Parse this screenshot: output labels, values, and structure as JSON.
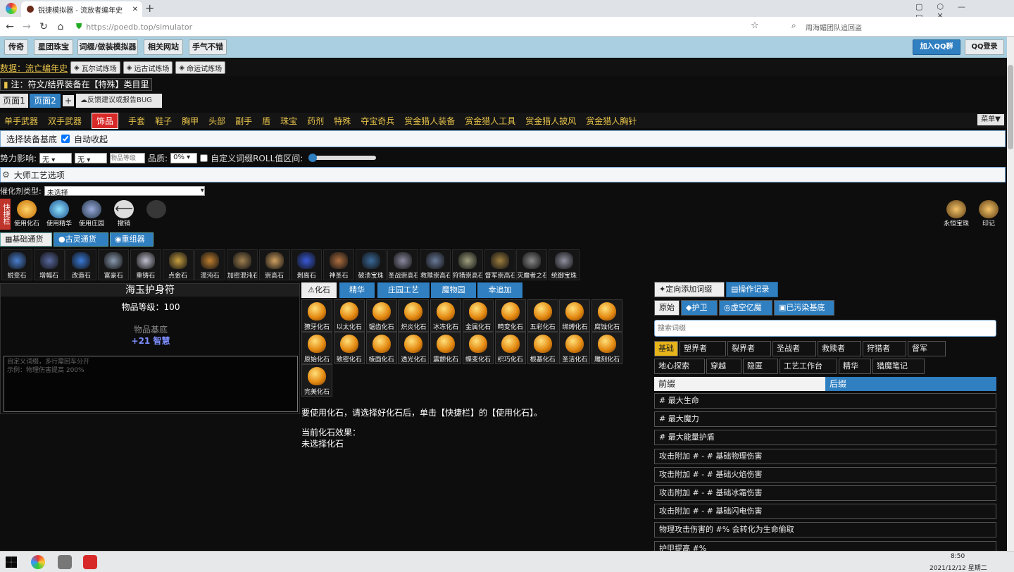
{
  "browser": {
    "tab_title": "锐捷模拟器 - 流放者编年史",
    "new_tab": "+",
    "url": "https://poedb.top/simulator",
    "search_hint": "周海媚团队追回盗"
  },
  "site": {
    "top_nav": [
      "传奇",
      "星团珠宝",
      "词缀/做装模拟器",
      "相关网站",
      "手气不错"
    ],
    "join_qq": "加入QQ群",
    "qq_login": "QQ登录",
    "data_label": "数据：流亡编年史",
    "trials": [
      "瓦尔试炼场",
      "远古试炼场",
      "命运试炼场"
    ],
    "note": "注：符文/结界装备在【特殊】类目里",
    "pages": [
      "页面1",
      "页面2",
      "+"
    ],
    "report_bug": "反馈建议或报告BUG",
    "categories": [
      "单手武器",
      "双手武器",
      "饰品",
      "手套",
      "鞋子",
      "胸甲",
      "头部",
      "副手",
      "盾",
      "珠宝",
      "药剂",
      "特殊",
      "夺宝奇兵",
      "赏金猎人装备",
      "赏金猎人工具",
      "赏金猎人披风",
      "赏金猎人胸针"
    ],
    "active_category": "饰品",
    "menu": "菜单▼",
    "select_base": "选择装备基底",
    "auto_collapse": "自动收起",
    "influence_label": "势力影响:",
    "influence_opt1": "无",
    "influence_opt2": "无",
    "item_level_placeholder": "物品等级",
    "quality_label": "品质:",
    "quality_value": "0%",
    "roll_label": "自定义词缀ROLL值区间:",
    "master_craft": "大师工艺选项",
    "catalyst_label": "催化剂类型:",
    "catalyst_value": "未选择",
    "quickbar_label": "快捷栏",
    "quick": [
      "使用化石",
      "使用精华",
      "使用庄园",
      "撤销",
      ""
    ],
    "quick_right": [
      "永恒宝珠",
      "印记"
    ],
    "sub_tabs": [
      "基础通货",
      "古灵通货",
      "重组器"
    ],
    "currencies": [
      "蜕变石",
      "增幅石",
      "改造石",
      "富豪石",
      "重铸石",
      "点金石",
      "混沌石",
      "加密混沌石",
      "崇高石",
      "剥离石",
      "神圣石",
      "破溃宝珠",
      "圣战崇高石",
      "救赎崇高石",
      "狩猎崇高石",
      "督军崇高石",
      "灭魔者之石",
      "统御宝珠"
    ],
    "item": {
      "name": "海玉护身符",
      "level": "物品等级：100",
      "base_label": "物品基底",
      "base_mod": "+21 智慧",
      "textarea_line1": "自定义词缀，多行需回车分开",
      "textarea_line2": "示例：物理伤害提高 200%"
    },
    "mid_tabs": [
      "化石",
      "精华",
      "庄园工艺",
      "魔物园",
      "幸追加"
    ],
    "fossils": [
      "獠牙化石",
      "以太化石",
      "锯齿化石",
      "炽炎化石",
      "冰冻化石",
      "金属化石",
      "畸变化石",
      "五彩化石",
      "绑缚化石",
      "腐蚀化石",
      "原始化石",
      "致密化石",
      "棱面化石",
      "透光化石",
      "震颤化石",
      "蝶变化石",
      "织巧化石",
      "根基化石",
      "圣洁化石",
      "雕刻化石",
      "完美化石"
    ],
    "fossil_hint": "要使用化石，请选择好化石后，单击【快捷栏】的【使用化石】。",
    "fossil_effect_label": "当前化石效果：",
    "fossil_effect_value": "未选择化石",
    "right_tabs": [
      "定向添加词缀",
      "操作记录"
    ],
    "right_subtabs": [
      "原始",
      "护卫",
      "虚空亿魔",
      "已污染基底"
    ],
    "search_placeholder": "搜索词缀",
    "filters_row1": [
      "基础",
      "塑界者",
      "裂界者",
      "圣战者",
      "救赎者",
      "狩猎者",
      "督军"
    ],
    "filters_row2": [
      "地心探索",
      "穿越",
      "隐匿",
      "工艺工作台",
      "精华",
      "猎魔笔记"
    ],
    "prefix": "前缀",
    "suffix": "后缀",
    "affixes": [
      "# 最大生命",
      "# 最大魔力",
      "# 最大能量护盾",
      "攻击附加 # - # 基础物理伤害",
      "攻击附加 # - # 基础火焰伤害",
      "攻击附加 # - # 基础冰霜伤害",
      "攻击附加 # - # 基础闪电伤害",
      "物理攻击伤害的 #% 会转化为生命偷取",
      "护甲提高 #%"
    ]
  },
  "taskbar": {
    "time": "8:50",
    "date": "2021/12/12 星期二"
  }
}
